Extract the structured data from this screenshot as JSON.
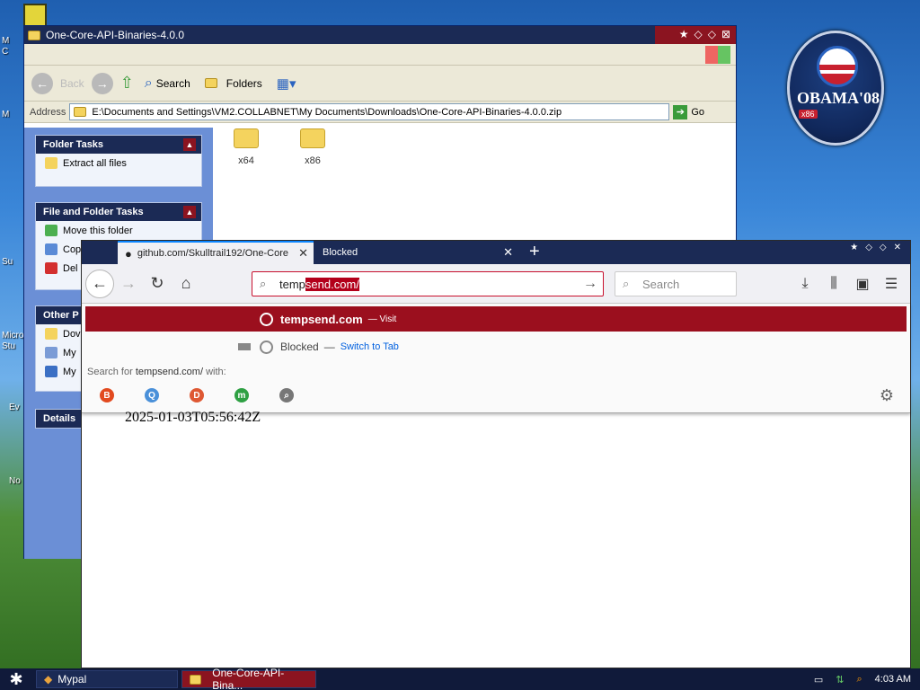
{
  "desktop": {
    "icon_labels": [
      "M",
      "C",
      "M",
      "Su",
      "Micro",
      "Stu",
      "Ev",
      "No"
    ],
    "obama": {
      "text": "OBAMA'08",
      "tag": "x86"
    }
  },
  "explorer": {
    "title": "One-Core-API-Binaries-4.0.0",
    "toolbar": {
      "back": "Back",
      "search": "Search",
      "folders": "Folders"
    },
    "address_label": "Address",
    "address_value": "E:\\Documents and Settings\\VM2.COLLABNET\\My Documents\\Downloads\\One-Core-API-Binaries-4.0.0.zip",
    "go_label": "Go",
    "folder_tasks": {
      "title": "Folder Tasks",
      "items": [
        "Extract all files"
      ]
    },
    "file_folder_tasks": {
      "title": "File and Folder Tasks",
      "items": [
        "Move this folder",
        "Cop",
        "Del"
      ]
    },
    "other_places": {
      "title": "Other P",
      "items": [
        "Dov",
        "My",
        "My"
      ]
    },
    "details": {
      "title": "Details"
    },
    "folders": [
      "x64",
      "x86"
    ]
  },
  "firefox": {
    "tabs": [
      {
        "label": "github.com/Skulltrail192/One-Core"
      },
      {
        "label": "Blocked"
      }
    ],
    "url_typed": "temp",
    "url_selected": "send.com/",
    "search_placeholder": "Search",
    "popup": {
      "visit_bold": "tempsend.com",
      "visit_suffix": "— Visit",
      "blocked_title": "Blocked",
      "blocked_dash": "—",
      "switch_to_tab": "Switch to Tab",
      "search_for_prefix": "Search for",
      "search_for_term": "tempsend.com/",
      "search_for_suffix": "with:",
      "engines": [
        {
          "name": "brave-icon",
          "glyph": "B",
          "color": "#e24a1f"
        },
        {
          "name": "qwant-icon",
          "glyph": "Q",
          "color": "#4a90d9"
        },
        {
          "name": "duckduckgo-icon",
          "glyph": "D",
          "color": "#de5833"
        },
        {
          "name": "mojeek-icon",
          "glyph": "m",
          "color": "#2ea043"
        },
        {
          "name": "generic-search-icon",
          "glyph": "⌕",
          "color": "#777777"
        }
      ]
    },
    "page_text": "2025-01-03T05:56:42Z"
  },
  "taskbar": {
    "items": [
      "Mypal",
      "One-Core-API-Bina..."
    ],
    "clock": "4:03 AM"
  }
}
